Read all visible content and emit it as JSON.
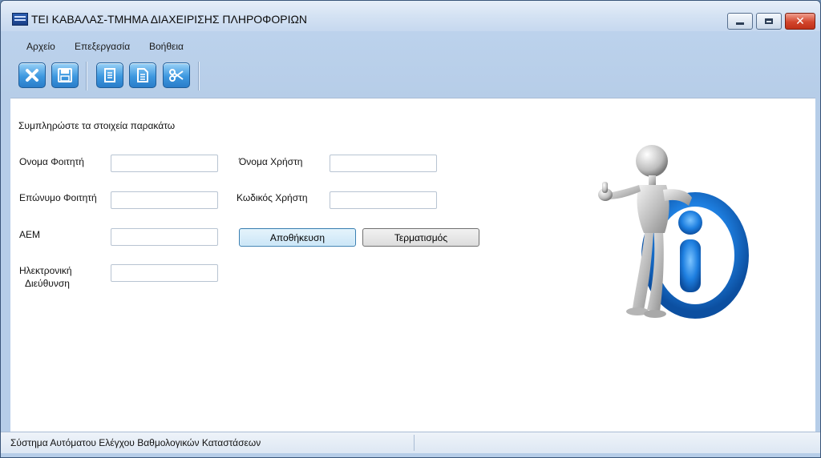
{
  "window": {
    "title": "ΤΕΙ ΚΑΒΑΛΑΣ-ΤΜΗΜΑ ΔΙΑΧΕΙΡΙΣΗΣ ΠΛΗΡΟΦΟΡΙΩΝ"
  },
  "menu": [
    {
      "label": "Αρχείο"
    },
    {
      "label": "Επεξεργασία"
    },
    {
      "label": "Βοήθεια"
    }
  ],
  "toolbar": {
    "buttons": [
      {
        "icon": "close-icon"
      },
      {
        "icon": "save-icon"
      },
      {
        "icon": "copy-icon"
      },
      {
        "icon": "paste-icon"
      },
      {
        "icon": "cut-icon"
      }
    ]
  },
  "form": {
    "instruction": "Συμπληρώστε τα στοιχεία παρακάτω",
    "student_first_name_label": "Ονομα Φοιτητή",
    "student_last_name_label": "Επώνυμο Φοιτητή",
    "aem_label": "ΑΕΜ",
    "email_label_line1": "Ηλεκτρονική",
    "email_label_line2": "Διεύθυνση",
    "username_label": "Όνομα Χρήστη",
    "password_label": "Κωδικός Χρήστη",
    "student_first_name_value": "",
    "student_last_name_value": "",
    "aem_value": "",
    "email_value": "",
    "username_value": "",
    "password_value": "",
    "save_label": "Αποθήκευση",
    "exit_label": "Τερματισμός"
  },
  "illustration": {
    "icon": "info-figure-icon",
    "accent": "#1e7fe0"
  },
  "status": {
    "text": "Σύστημα Αυτόματου Ελέγχου Βαθμολογικών Καταστάσεων"
  }
}
